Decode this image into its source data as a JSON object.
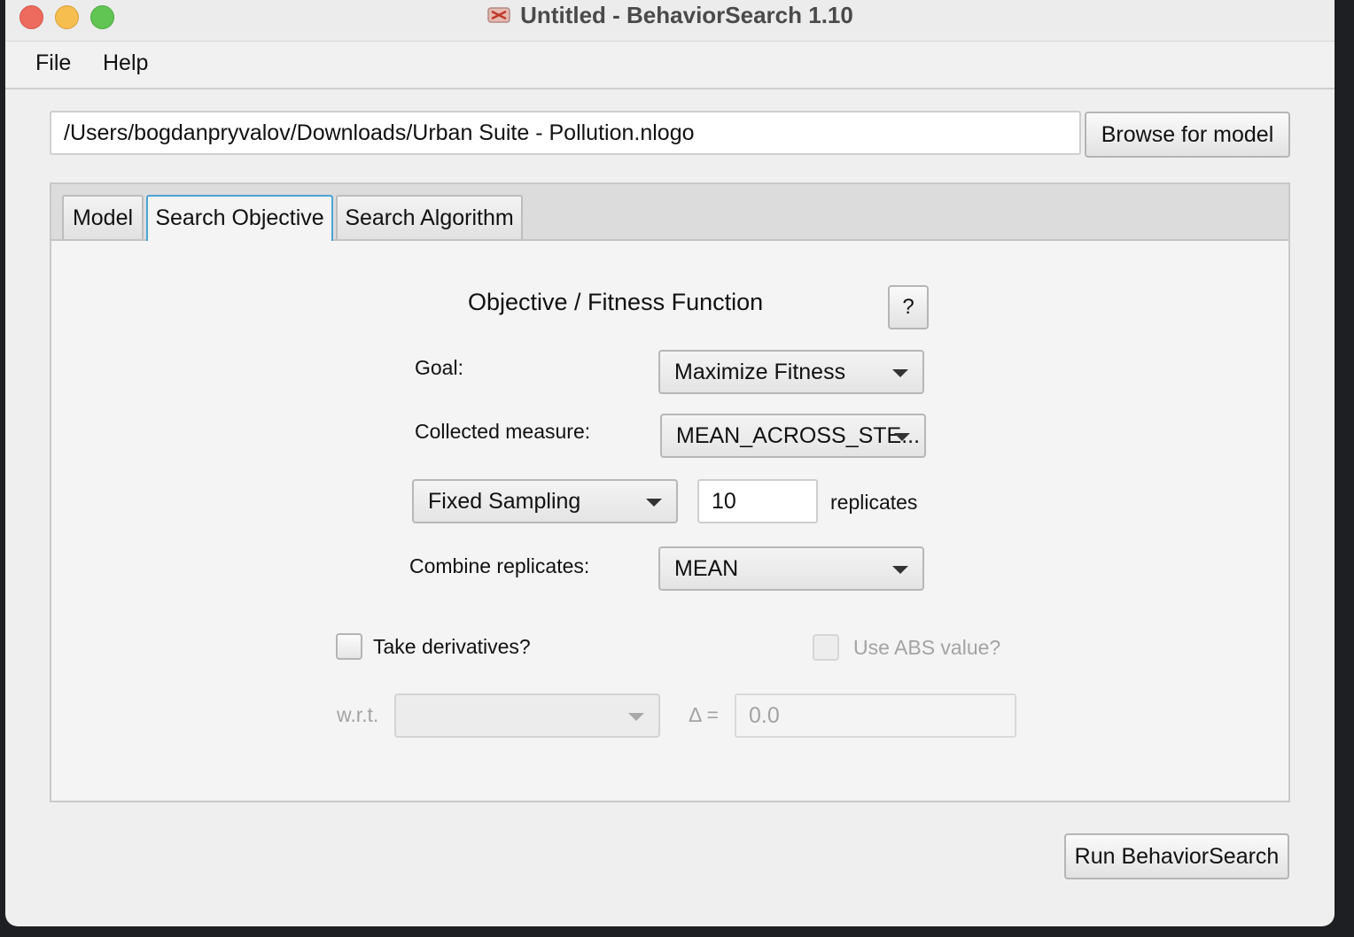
{
  "window": {
    "title": "Untitled - BehaviorSearch 1.10"
  },
  "menu": {
    "items": [
      "File",
      "Help"
    ]
  },
  "model_path": {
    "value": "/Users/bogdanpryvalov/Downloads/Urban Suite - Pollution.nlogo",
    "browse_label": "Browse for model"
  },
  "tabs": [
    {
      "label": "Model"
    },
    {
      "label": "Search Objective"
    },
    {
      "label": "Search Algorithm"
    }
  ],
  "objective": {
    "heading": "Objective / Fitness Function",
    "help_label": "?",
    "goal_label": "Goal:",
    "goal_value": "Maximize Fitness",
    "collected_label": "Collected measure:",
    "collected_value": "MEAN_ACROSS_STE...",
    "sampling_value": "Fixed Sampling",
    "replicates_value": "10",
    "replicates_label": "replicates",
    "combine_label": "Combine replicates:",
    "combine_value": "MEAN",
    "derivatives_label": "Take derivatives?",
    "abs_label": "Use ABS value?",
    "wrt_label": "w.r.t.",
    "wrt_value": "",
    "delta_label": "Δ =",
    "delta_value": "0.0"
  },
  "run_label": "Run BehaviorSearch"
}
